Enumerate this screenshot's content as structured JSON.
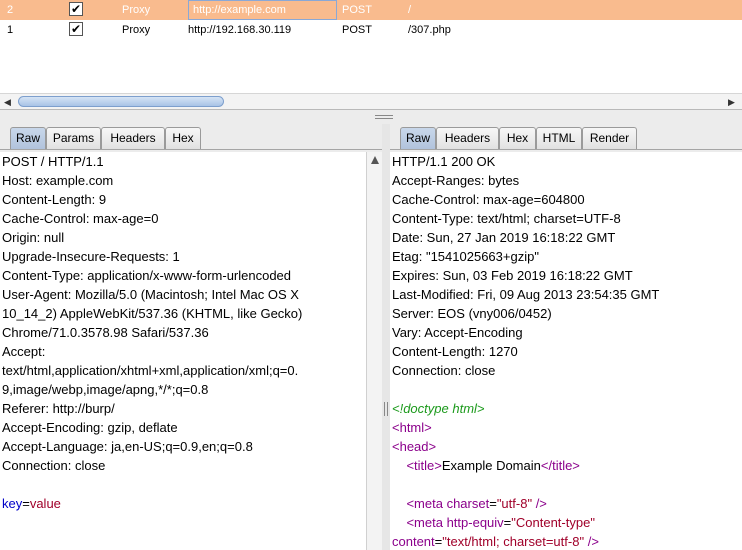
{
  "history": {
    "rows": [
      {
        "num": "2",
        "checked": "✔",
        "tool": "Proxy",
        "host": "http://example.com",
        "method": "POST",
        "url": "/"
      },
      {
        "num": "1",
        "checked": "✔",
        "tool": "Proxy",
        "host": "http://192.168.30.119",
        "method": "POST",
        "url": "/307.php"
      }
    ]
  },
  "request": {
    "tabs": [
      "Raw",
      "Params",
      "Headers",
      "Hex"
    ],
    "active_tab": "Raw",
    "lines": [
      "POST / HTTP/1.1",
      "Host: example.com",
      "Content-Length: 9",
      "Cache-Control: max-age=0",
      "Origin: null",
      "Upgrade-Insecure-Requests: 1",
      "Content-Type: application/x-www-form-urlencoded",
      "User-Agent: Mozilla/5.0 (Macintosh; Intel Mac OS X",
      "10_14_2) AppleWebKit/537.36 (KHTML, like Gecko)",
      "Chrome/71.0.3578.98 Safari/537.36",
      "Accept:",
      "text/html,application/xhtml+xml,application/xml;q=0.",
      "9,image/webp,image/apng,*/*;q=0.8",
      "Referer: http://burp/",
      "Accept-Encoding: gzip, deflate",
      "Accept-Language: ja,en-US;q=0.9,en;q=0.8",
      "Connection: close",
      ""
    ],
    "body": {
      "key": "key",
      "eq": "=",
      "value": "value"
    }
  },
  "response": {
    "tabs": [
      "Raw",
      "Headers",
      "Hex",
      "HTML",
      "Render"
    ],
    "active_tab": "Raw",
    "header_lines": [
      "HTTP/1.1 200 OK",
      "Accept-Ranges: bytes",
      "Cache-Control: max-age=604800",
      "Content-Type: text/html; charset=UTF-8",
      "Date: Sun, 27 Jan 2019 16:18:22 GMT",
      "Etag: \"1541025663+gzip\"",
      "Expires: Sun, 03 Feb 2019 16:18:22 GMT",
      "Last-Modified: Fri, 09 Aug 2013 23:54:35 GMT",
      "Server: EOS (vny006/0452)",
      "Vary: Accept-Encoding",
      "Content-Length: 1270",
      "Connection: close",
      ""
    ],
    "html": {
      "doctype": "<!doctype html>",
      "html_open": "<html>",
      "head_open": "<head>",
      "title_open": "<title>",
      "title_text": "Example Domain",
      "title_close": "</title>",
      "meta1_tag": "<meta",
      "meta1_attr": "charset",
      "meta1_val": "\"utf-8\"",
      "meta1_end": "/>",
      "meta2_tag": "<meta",
      "meta2_attr": "http-equiv",
      "meta2_val": "\"Content-type\"",
      "meta3_attr": "content",
      "meta3_val": "\"text/html; charset=utf-8\"",
      "meta3_end": "/>"
    }
  }
}
